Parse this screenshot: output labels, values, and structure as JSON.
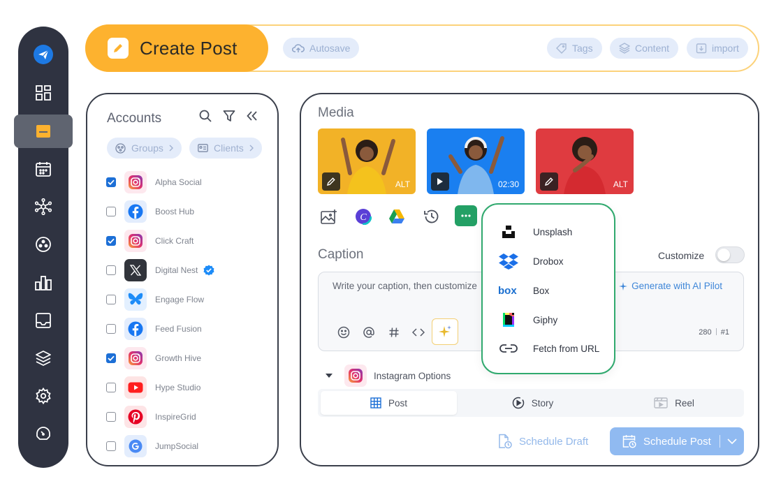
{
  "header": {
    "title": "Create Post",
    "autosave": "Autosave",
    "tags": "Tags",
    "content": "Content",
    "import": "import"
  },
  "accounts": {
    "title": "Accounts",
    "groups": "Groups",
    "clients": "Clients",
    "items": [
      {
        "name": "Alpha Social",
        "network": "instagram",
        "checked": true
      },
      {
        "name": "Boost Hub",
        "network": "facebook",
        "checked": false
      },
      {
        "name": "Click Craft",
        "network": "instagram",
        "checked": true
      },
      {
        "name": "Digital Nest",
        "network": "x",
        "checked": false,
        "verified": true
      },
      {
        "name": "Engage Flow",
        "network": "bluesky",
        "checked": false
      },
      {
        "name": "Feed Fusion",
        "network": "facebook",
        "checked": false
      },
      {
        "name": "Growth Hive",
        "network": "instagram",
        "checked": true
      },
      {
        "name": "Hype Studio",
        "network": "youtube",
        "checked": false
      },
      {
        "name": "InspireGrid",
        "network": "pinterest",
        "checked": false
      },
      {
        "name": "JumpSocial",
        "network": "google",
        "checked": false
      }
    ]
  },
  "media": {
    "title": "Media",
    "thumbs": [
      {
        "badge": "ALT",
        "kind": "image"
      },
      {
        "badge": "02:30",
        "kind": "video"
      },
      {
        "badge": "ALT",
        "kind": "image"
      }
    ]
  },
  "dropdown": {
    "items": [
      "Unsplash",
      "Drobox",
      "Box",
      "Giphy",
      "Fetch from URL"
    ]
  },
  "caption": {
    "title": "Caption",
    "customize_label": "Customize",
    "customize_on": false,
    "placeholder": "Write your caption, then customize",
    "ai_link": "Generate with AI Pilot",
    "char_count": "280",
    "post_index": "#1"
  },
  "instagram": {
    "label": "Instagram Options",
    "tabs": [
      "Post",
      "Story",
      "Reel"
    ],
    "active_tab": "Post"
  },
  "actions": {
    "schedule_draft": "Schedule Draft",
    "schedule_post": "Schedule Post"
  },
  "colors": {
    "accent": "#fdb22f",
    "rail": "#2f3341",
    "primary_blue": "#1c6fd6",
    "menu_border": "#30a96e"
  }
}
